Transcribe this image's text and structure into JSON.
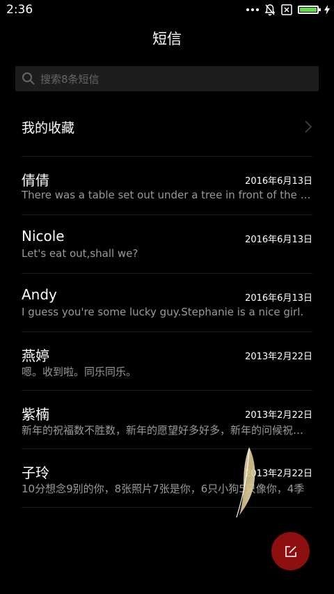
{
  "status_bar": {
    "time": "2:36",
    "battery_level": 1.0,
    "battery_color": "#5ddb43",
    "icons": [
      "more-dots-icon",
      "bell-muted-icon",
      "sim-blocked-icon",
      "battery-icon",
      "charging-bolt-icon"
    ]
  },
  "header": {
    "title": "短信"
  },
  "search": {
    "placeholder": "搜索8条短信"
  },
  "favorites": {
    "label": "我的收藏"
  },
  "conversations": [
    {
      "name": "倩倩",
      "date": "2016年6月13日",
      "preview": "There was a table set out under a tree in front of the house"
    },
    {
      "name": "Nicole",
      "date": "2016年6月13日",
      "preview": "Let's eat out,shall we?"
    },
    {
      "name": "Andy",
      "date": "2016年6月13日",
      "preview": "I guess you're some lucky guy.Stephanie is a nice girl."
    },
    {
      "name": "燕婷",
      "date": "2013年2月22日",
      "preview": "嗯。收到啦。同乐同乐。"
    },
    {
      "name": "紫楠",
      "date": "2013年2月22日",
      "preview": "新年的祝福数不胜数，新年的愿望好多好多，新年的问候祝你新年快乐"
    },
    {
      "name": "子玲",
      "date": "2013年2月22日",
      "preview": "10分想念9别的你，8张照片7张是你，6只小狗5只像你，4季"
    }
  ],
  "compose": {
    "color": "#8e0f0f",
    "icon": "compose-icon"
  }
}
